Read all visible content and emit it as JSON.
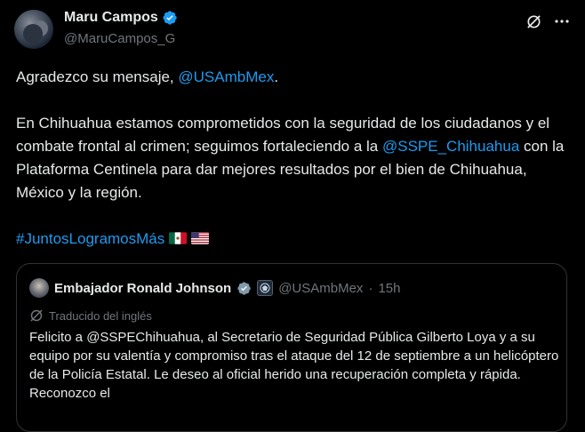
{
  "author": {
    "name": "Maru Campos",
    "handle": "@MaruCampos_G"
  },
  "tweet": {
    "line1_text": "Agradezco su mensaje, ",
    "line1_mention": "@USAmbMex",
    "line1_end": ".",
    "para2_start": "En Chihuahua estamos comprometidos con la seguridad de los ciudadanos y el combate frontal al crimen; seguimos fortaleciendo a la ",
    "para2_mention": "@SSPE_Chihuahua",
    "para2_end": " con la Plataforma Centinela para dar mejores resultados por el bien de Chihuahua, México y la región.",
    "hashtag": "#JuntosLogramosMás"
  },
  "quote": {
    "name": "Embajador Ronald Johnson",
    "handle": "@USAmbMex",
    "separator": "·",
    "time": "15h",
    "translated_label": "Traducido del inglés",
    "text": "Felicito a @SSPEChihuahua, al Secretario de Seguridad Pública Gilberto Loya y a su equipo por su valentía y compromiso tras el ataque del 12 de septiembre a un helicóptero de la Policía Estatal. Le deseo al oficial herido una recuperación completa y rápida. Reconozco el"
  },
  "colors": {
    "background": "#000000",
    "text": "#e7e9ea",
    "muted": "#71767b",
    "link": "#1d9bf0",
    "border": "#2f3336"
  },
  "icons": [
    "verified-badge-icon",
    "grok-icon",
    "more-icon",
    "mexico-flag-icon",
    "us-flag-icon",
    "translate-icon",
    "embassy-seal-icon"
  ]
}
